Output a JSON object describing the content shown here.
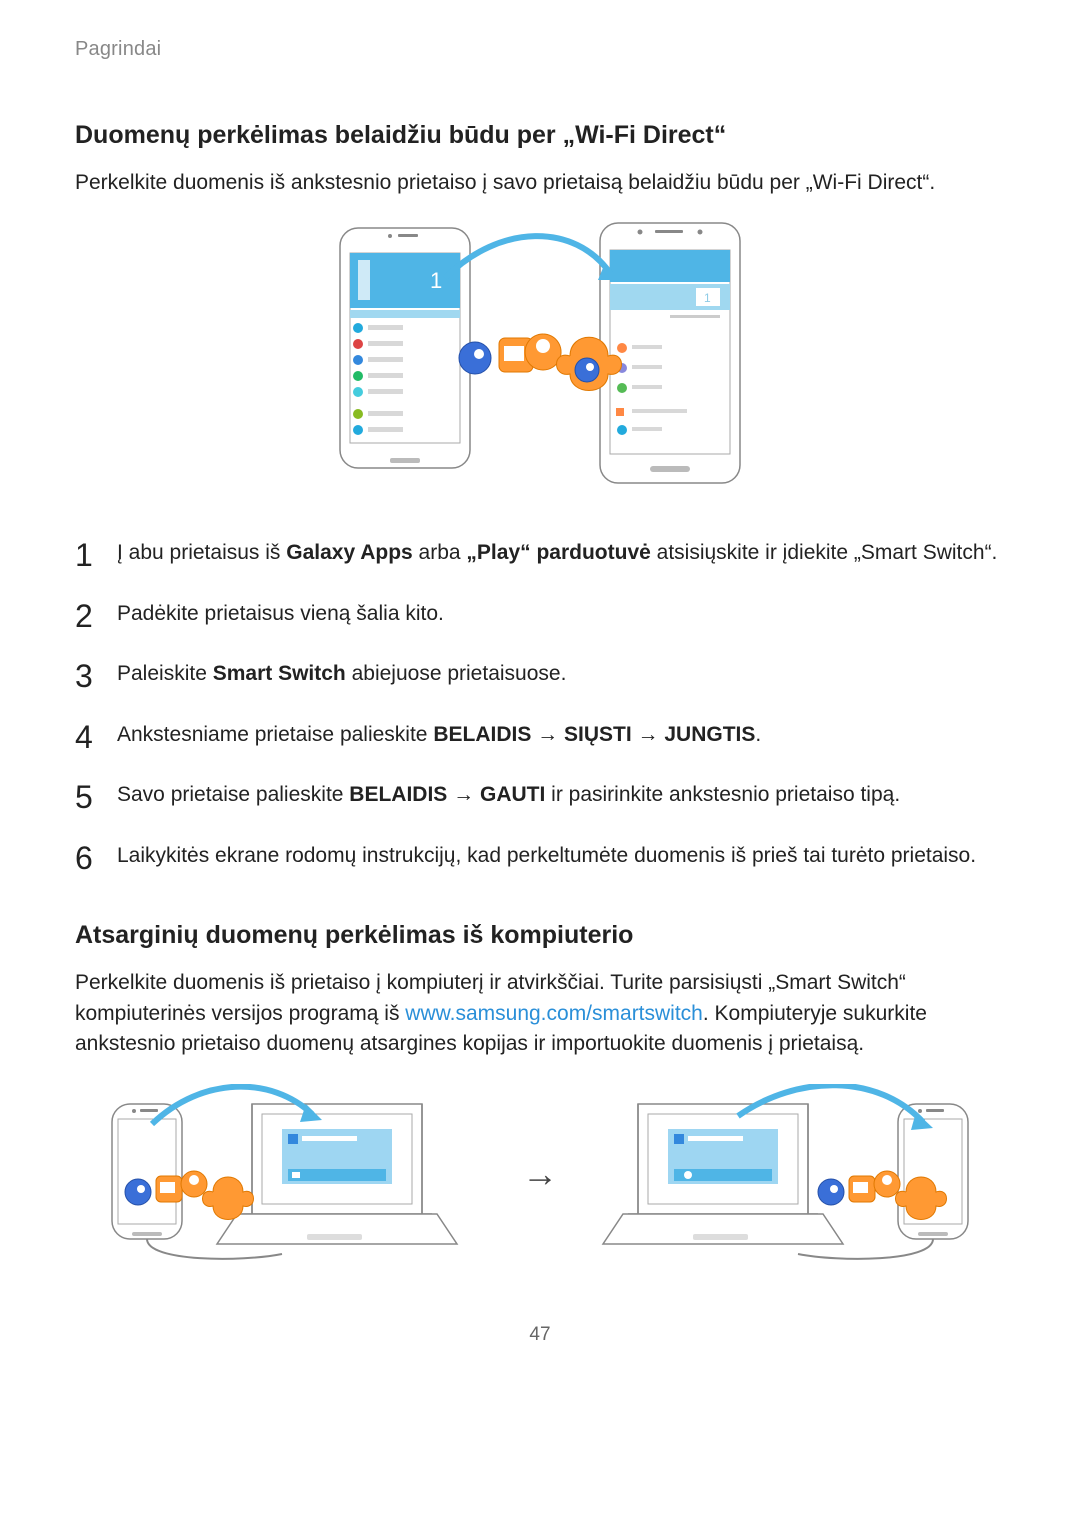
{
  "breadcrumb": "Pagrindai",
  "section1": {
    "title": "Duomenų perkėlimas belaidžiu būdu per „Wi-Fi Direct“",
    "intro": "Perkelkite duomenis iš ankstesnio prietaiso į savo prietaisą belaidžiu būdu per „Wi‑Fi Direct“."
  },
  "steps": {
    "s1": {
      "pre": "Į abu prietaisus iš ",
      "b1": "Galaxy Apps",
      "mid1": " arba ",
      "b2": "„Play“ parduotuvė",
      "post": " atsisiųskite ir įdiekite „Smart Switch“."
    },
    "s2": "Padėkite prietaisus vieną šalia kito.",
    "s3": {
      "pre": "Paleiskite ",
      "b1": "Smart Switch",
      "post": " abiejuose prietaisuose."
    },
    "s4": {
      "pre": "Ankstesniame prietaise palieskite ",
      "b1": "BELAIDIS",
      "arrow1": " → ",
      "b2": "SIŲSTI",
      "arrow2": " → ",
      "b3": "JUNGTIS",
      "post": "."
    },
    "s5": {
      "pre": "Savo prietaise palieskite ",
      "b1": "BELAIDIS",
      "arrow1": " → ",
      "b2": "GAUTI",
      "post": " ir pasirinkite ankstesnio prietaiso tipą."
    },
    "s6": "Laikykitės ekrane rodomų instrukcijų, kad perkeltumėte duomenis iš prieš tai turėto prietaiso."
  },
  "section2": {
    "title": "Atsarginių duomenų perkėlimas iš kompiuterio",
    "pre": "Perkelkite duomenis iš prietaiso į kompiuterį ir atvirkščiai. Turite parsisiųsti „Smart Switch“ kompiuterinės versijos programą iš ",
    "link_text": "www.samsung.com/smartswitch",
    "link_href": "http://www.samsung.com/smartswitch",
    "post": ". Kompiuteryje sukurkite ankstesnio prietaiso duomenų atsargines kopijas ir importuokite duomenis į prietaisą."
  },
  "page_number": "47"
}
